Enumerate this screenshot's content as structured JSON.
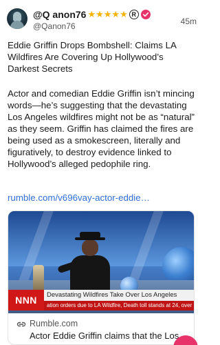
{
  "post": {
    "display_name": "@Q anon76",
    "stars": "★★★★★",
    "registered_mark": "R",
    "handle": "@Qanon76",
    "time": "45m",
    "headline": "Eddie Griffin Drops Bombshell: Claims LA Wildfires Are Covering Up Hollywood’s Darkest Secrets",
    "body": "Actor and comedian Eddie Griffin isn’t mincing words—he’s suggesting that the devastating Los Angeles wildfires might not be as “natural” as they seem. Griffin has claimed the fires are being used as a smokescreen, literally and figuratively, to destroy evidence linked to Hollywood’s alleged pedophile ring.",
    "link_text": "rumble.com/v696vay-actor-eddie…"
  },
  "card": {
    "ticker_brand": "NNN",
    "ticker_headline": "Devastating Wildfires Take Over Los Angeles",
    "ticker_sub": "ation orders due to LA Wildfire, Death toll stands at 24, over 38,000 acres a",
    "domain": "Rumble.com",
    "title": "Actor Eddie Griffin claims that the Los…"
  },
  "icons": {
    "verified": "verified-badge-icon",
    "link": "link-icon"
  },
  "colors": {
    "stars": "#f5b301",
    "verified": "#e8336a",
    "link": "#2f6fd6",
    "ticker_red": "#d01818"
  }
}
